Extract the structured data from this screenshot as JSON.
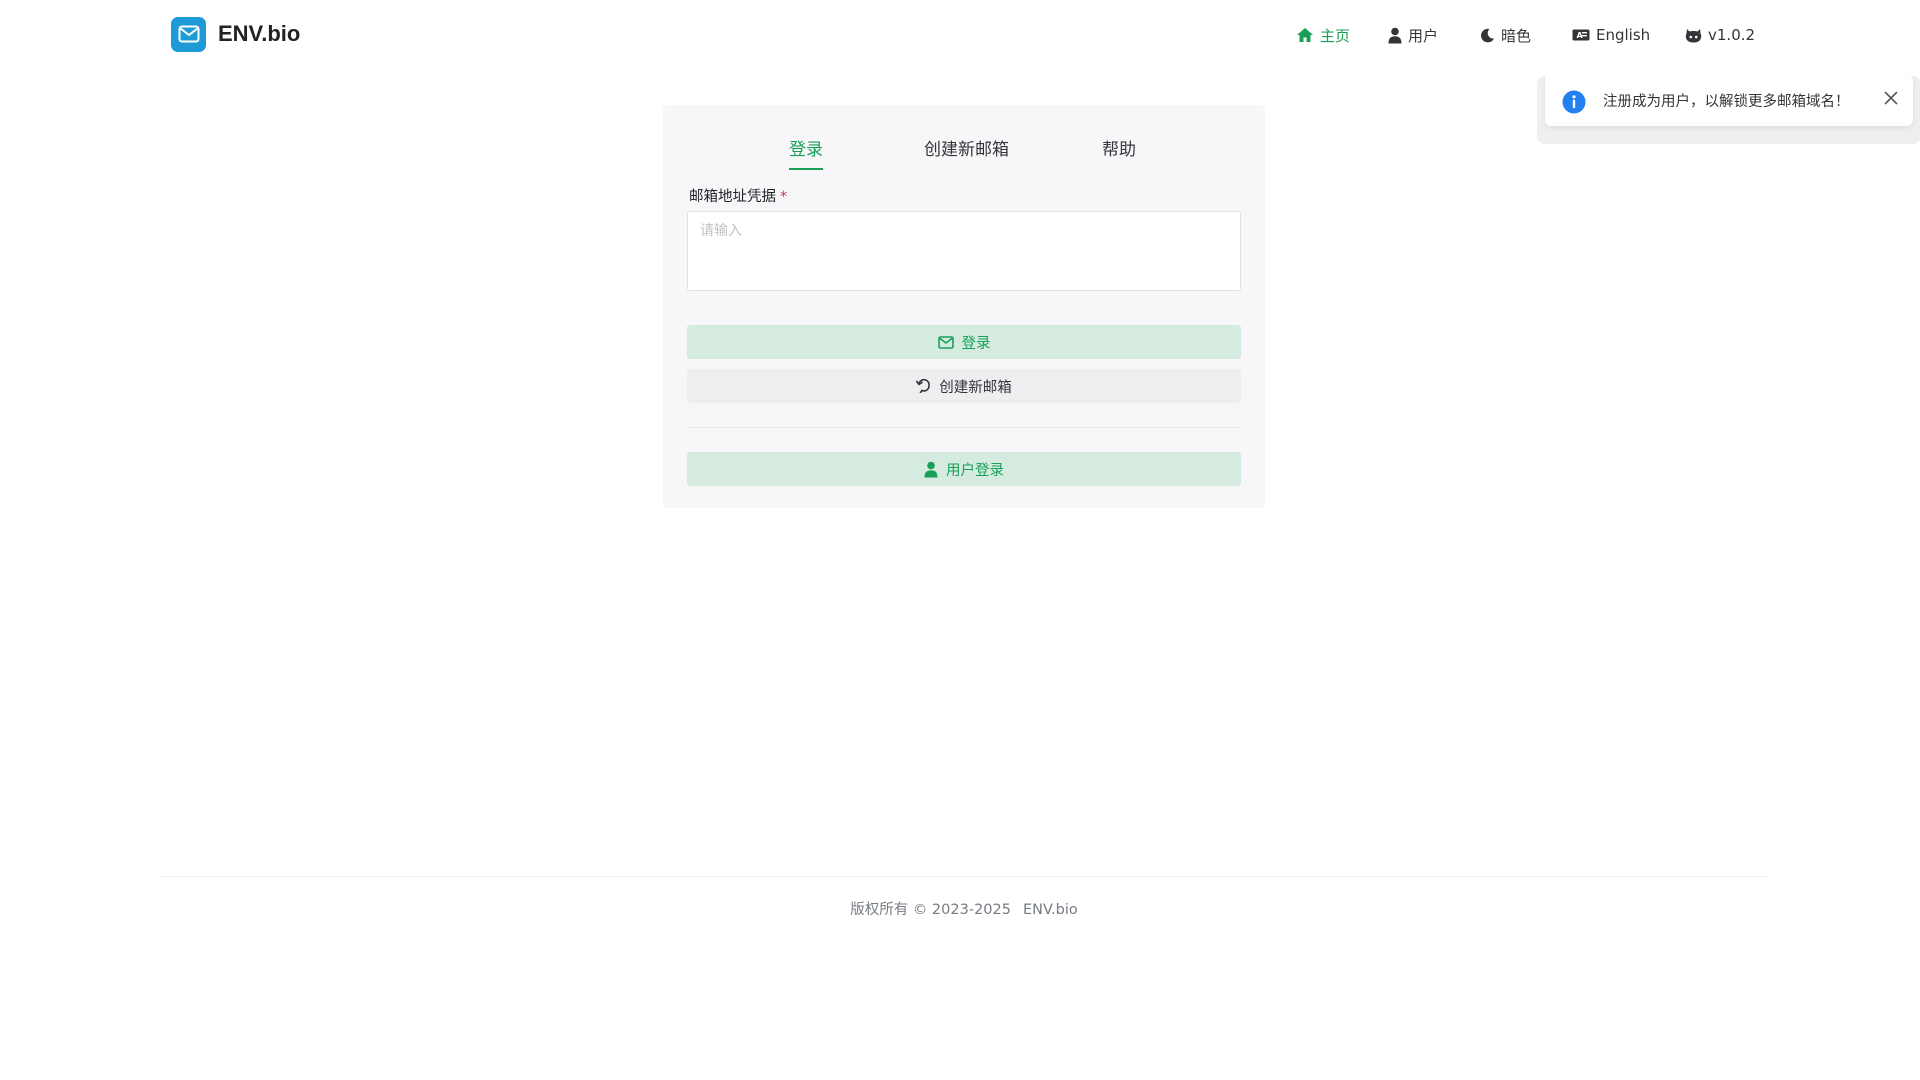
{
  "brand": {
    "title": "ENV.bio",
    "icon": "mail-icon",
    "color": "#1d9bd7"
  },
  "nav": {
    "items": [
      {
        "label": "主页",
        "icon": "home-icon",
        "active": true
      },
      {
        "label": "用户",
        "icon": "user-icon",
        "active": false
      },
      {
        "label": "暗色",
        "icon": "moon-icon",
        "active": false
      },
      {
        "label": "English",
        "icon": "language-icon",
        "active": false
      },
      {
        "label": "v1.0.2",
        "icon": "github-icon",
        "active": false
      }
    ]
  },
  "toast": {
    "message": "注册成为用户，以解锁更多邮箱域名！",
    "icon": "info-icon",
    "close_icon": "close-icon"
  },
  "login_card": {
    "tabs": [
      {
        "label": "登录",
        "active": true
      },
      {
        "label": "创建新邮箱",
        "active": false
      },
      {
        "label": "帮助",
        "active": false
      }
    ],
    "credential_label": "邮箱地址凭据",
    "required_mark": "*",
    "credential_input": {
      "value": "",
      "placeholder": "请输入"
    },
    "login_button": "登录",
    "create_button": "创建新邮箱",
    "user_login_button": "用户登录"
  },
  "footer": {
    "copyright": "版权所有 © 2023-2025",
    "site": "ENV.bio"
  },
  "colors": {
    "accent": "#18a058",
    "accent_light": "#d5ebe0",
    "required": "#d03050",
    "info": "#2080f0"
  }
}
